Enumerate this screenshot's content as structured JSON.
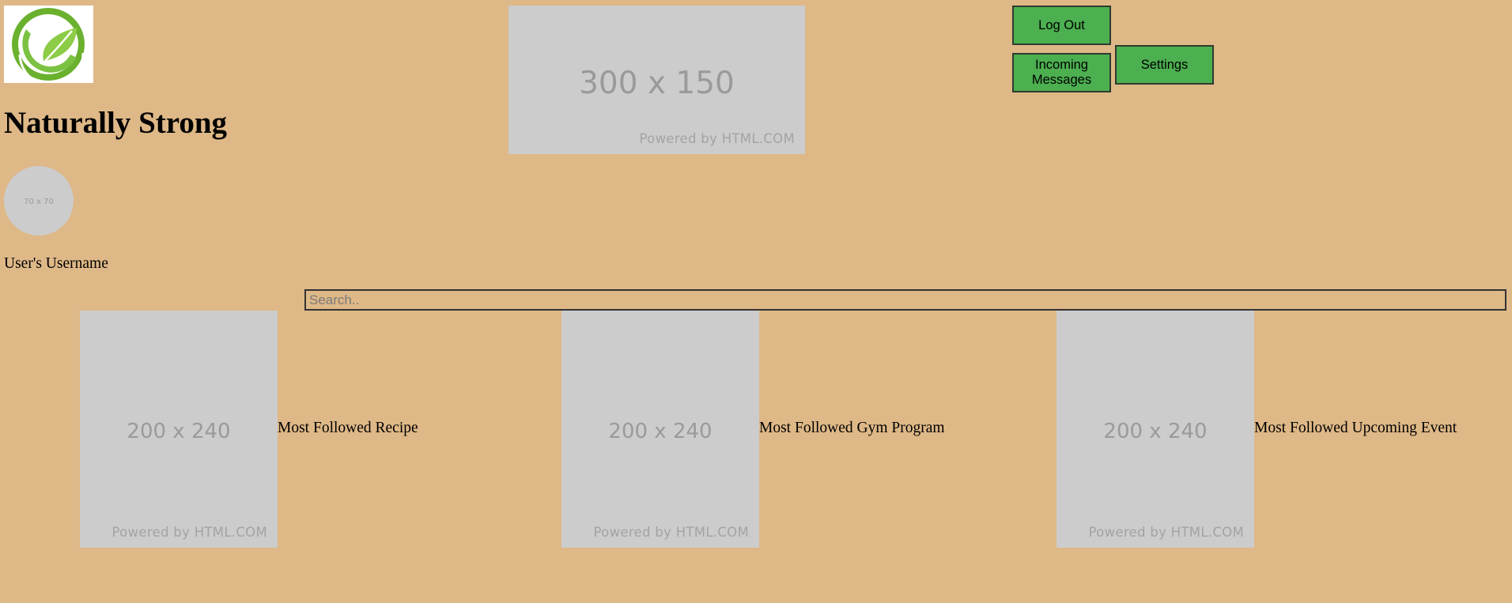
{
  "header": {
    "site_title": "Naturally Strong",
    "banner": {
      "size_text": "300 x 150",
      "credit": "Powered by HTML.COM"
    }
  },
  "actions": {
    "logout_label": "Log Out",
    "messages_label": "Incoming Messages",
    "settings_label": "Settings"
  },
  "profile": {
    "avatar_text": "70 x 70",
    "username": "User's Username"
  },
  "search": {
    "placeholder": "Search.."
  },
  "featured": [
    {
      "img_text": "200 x 240",
      "credit": "Powered by HTML.COM",
      "label": "Most Followed Recipe"
    },
    {
      "img_text": "200 x 240",
      "credit": "Powered by HTML.COM",
      "label": "Most Followed Gym Program"
    },
    {
      "img_text": "200 x 240",
      "credit": "Powered by HTML.COM",
      "label": "Most Followed Upcoming Event"
    }
  ],
  "colors": {
    "background": "#deb887",
    "button": "#4caf50",
    "placeholder": "#cccccc",
    "logo_green": "#7ac142"
  },
  "icons": {
    "logo": "leaf-swirl-logo-icon"
  }
}
